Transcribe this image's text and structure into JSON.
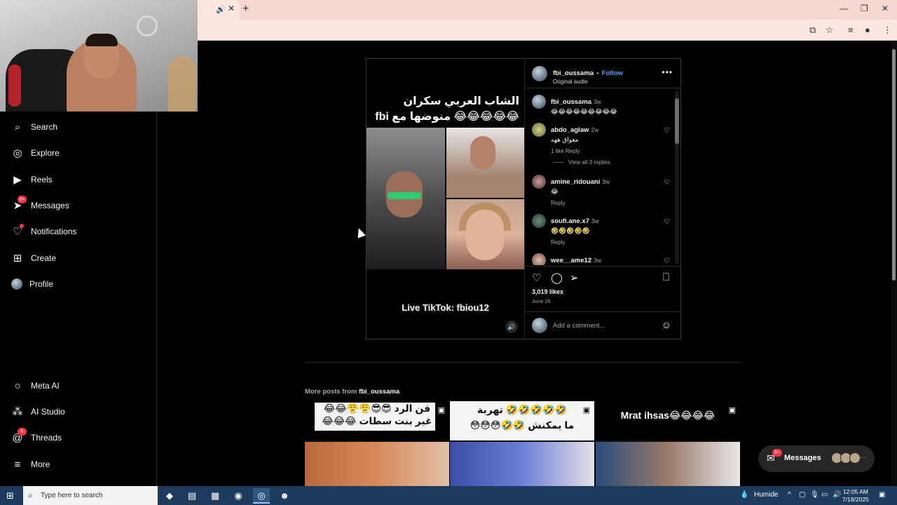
{
  "browser": {
    "tab_audio_icon": "speaker-icon",
    "new_tab_label": "+",
    "window_controls": [
      "—",
      "❐",
      "✕"
    ]
  },
  "sidebar": {
    "items": [
      {
        "label": "Search",
        "icon": "search-icon",
        "glyph": "⌕"
      },
      {
        "label": "Explore",
        "icon": "compass-icon",
        "glyph": "◎"
      },
      {
        "label": "Reels",
        "icon": "reels-icon",
        "glyph": "▶"
      },
      {
        "label": "Messages",
        "icon": "send-icon",
        "glyph": "➤",
        "badge": "9+"
      },
      {
        "label": "Notifications",
        "icon": "heart-icon",
        "glyph": "♡"
      },
      {
        "label": "Create",
        "icon": "plus-square-icon",
        "glyph": "⊞"
      },
      {
        "label": "Profile",
        "icon": "avatar",
        "glyph": "●"
      },
      {
        "label": "Meta AI",
        "icon": "meta-ai-icon",
        "glyph": "○"
      },
      {
        "label": "AI Studio",
        "icon": "ai-studio-icon",
        "glyph": "⁂"
      },
      {
        "label": "Threads",
        "icon": "threads-icon",
        "glyph": "@",
        "badge": "6"
      },
      {
        "label": "More",
        "icon": "menu-icon",
        "glyph": "≡"
      }
    ]
  },
  "post": {
    "media_title_line1": "الشاب العربي سكران",
    "media_title_line2": "😂😂😂😂😂 منوضها مع fbi",
    "watermark": "Live TikTok: fbiou12",
    "header": {
      "username": "fbi_oussama",
      "separator": "•",
      "follow": "Follow",
      "audio": "Original audio"
    },
    "comments": [
      {
        "user": "fbi_oussama",
        "time": "3w",
        "text": "😂😂😂😂😂😂😂😂😂",
        "meta": ""
      },
      {
        "user": "abdo_aglaw",
        "time": "2w",
        "text": "معواق ههه",
        "meta": "1 like   Reply"
      },
      {
        "user": "amine_ridouani",
        "time": "3w",
        "text": "😂",
        "meta": "Reply"
      },
      {
        "user": "soufi.ane.x7",
        "time": "3w",
        "text": "🤣🤣🤣🤣🤣",
        "meta": "Reply"
      },
      {
        "user": "wee__ame12",
        "time": "3w",
        "text": "🤣🤣🤣🤣",
        "meta": ""
      }
    ],
    "view_replies": "View all 3 replies",
    "likes": "3,019 likes",
    "date": "June 26",
    "add_comment_placeholder": "Add a comment..."
  },
  "more_posts": {
    "label": "More posts from",
    "user": "fbi_oussama",
    "tiles": [
      {
        "line1": "فن الرد 😎😎😤😤😂😂",
        "line2": "غير بنت سطات 😂😂😂"
      },
      {
        "line1": "🤣🤣🤣🤣🤣 تهربة",
        "line2": "ما يمكنش 🤣🤣😳😳😳"
      },
      {
        "line1": "Mrat ihsas😂😂😂😂",
        "line2": ""
      }
    ]
  },
  "messages_pill": {
    "label": "Messages",
    "badge": "9+",
    "more": "···"
  },
  "taskbar": {
    "search_placeholder": "Type here to search",
    "weather": "Humide",
    "time": "12:05 AM",
    "date": "7/18/2025"
  }
}
